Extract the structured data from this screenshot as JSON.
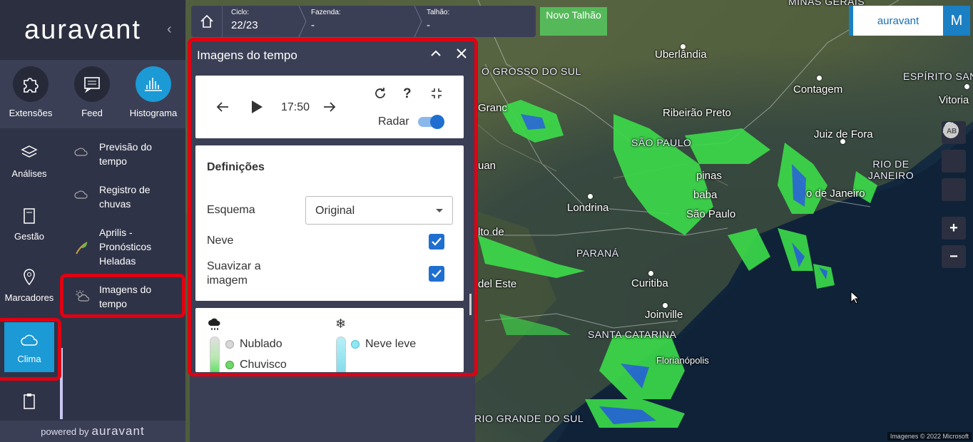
{
  "brand": {
    "logo": "auravant",
    "collapse": "‹"
  },
  "quick": [
    {
      "label": "Extensões",
      "icon": "puzzle-icon"
    },
    {
      "label": "Feed",
      "icon": "feed-icon"
    },
    {
      "label": "Histograma",
      "icon": "histogram-icon"
    }
  ],
  "rail": [
    {
      "label": "Análises",
      "icon": "layers-icon"
    },
    {
      "label": "Gestão",
      "icon": "book-icon"
    },
    {
      "label": "Marcadores",
      "icon": "pin-icon"
    },
    {
      "label": "Clima",
      "icon": "cloud-icon"
    },
    {
      "label": "",
      "icon": "clipboard-icon"
    }
  ],
  "submenu": [
    {
      "label": "Previsão do tempo",
      "icon": "cloud-icon"
    },
    {
      "label": "Registro de chuvas",
      "icon": "cloud-icon"
    },
    {
      "label": "Aprilis - Pronósticos Heladas",
      "icon": "leaf-icon"
    },
    {
      "label": "Imagens do tempo",
      "icon": "sun-cloud-icon"
    }
  ],
  "powered": {
    "text": "powered by",
    "brand": "auravant"
  },
  "topbar": {
    "ciclo_label": "Ciclo:",
    "ciclo_value": "22/23",
    "fazenda_label": "Fazenda:",
    "fazenda_value": "-",
    "talhao_label": "Talhão:",
    "talhao_value": "-"
  },
  "novo_talhao": "Novo Talhão",
  "account": {
    "name": "auravant",
    "initial": "M"
  },
  "panel": {
    "title": "Imagens do tempo",
    "player": {
      "time": "17:50",
      "radar_label": "Radar",
      "radar_on": true
    },
    "defs": {
      "heading": "Definições",
      "esquema_label": "Esquema",
      "esquema_value": "Original",
      "neve_label": "Neve",
      "neve_checked": true,
      "suavizar_label": "Suavizar a imagem",
      "suavizar_checked": true
    },
    "legend": {
      "rain": [
        "Nublado",
        "Chuvisco"
      ],
      "snow": [
        "Neve leve"
      ]
    }
  },
  "map": {
    "cities": [
      "Uberlândia",
      "Contagem",
      "Ribeirão Preto",
      "Juiz de Fora",
      "Londrina",
      "São Paulo",
      "Curitiba",
      "Joinville",
      "Vitoria",
      "Florianópolis",
      "Granc",
      "uan",
      "lto de",
      "del Este",
      "pinas",
      "baba",
      "o de Janeiro"
    ],
    "states": [
      "MINAS GERAIS",
      "O GROSSO DO SUL",
      "ESPÍRITO SANT",
      "SÃO PAULO",
      "RIO DE JANEIRO",
      "PARANÁ",
      "SANTA CATARINA",
      "RIO GRANDE DO SUL"
    ],
    "credit": "Imagenes © 2022 Microsoft"
  }
}
